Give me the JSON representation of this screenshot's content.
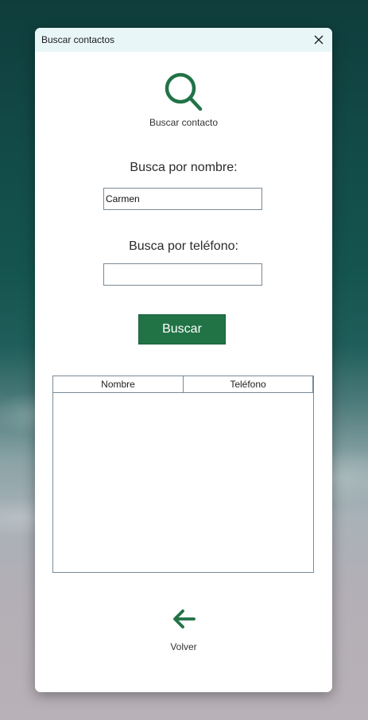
{
  "window": {
    "title": "Buscar contactos",
    "close_icon": "close-icon"
  },
  "header": {
    "icon": "search-icon",
    "caption": "Buscar contacto"
  },
  "form": {
    "name_label": "Busca por nombre:",
    "name_value": "Carmen",
    "phone_label": "Busca por teléfono:",
    "phone_value": ""
  },
  "actions": {
    "search_label": "Buscar",
    "back_icon": "arrow-left-icon",
    "back_label": "Volver"
  },
  "results": {
    "columns": [
      "Nombre",
      "Teléfono"
    ],
    "rows": []
  },
  "colors": {
    "accent": "#217346",
    "titlebar": "#e8f6f8"
  }
}
